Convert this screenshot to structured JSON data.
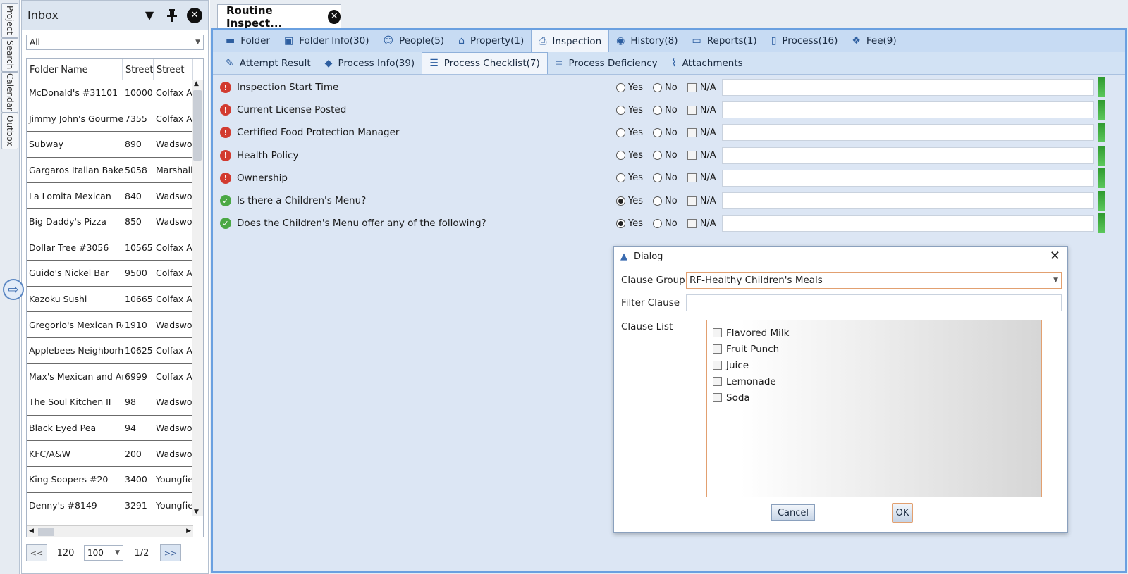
{
  "side_tabs": [
    "Project",
    "Search",
    "Calendar",
    "Outbox"
  ],
  "inbox": {
    "title": "Inbox",
    "filter": "All",
    "columns": [
      "Folder Name",
      "Street",
      "Street"
    ],
    "rows": [
      [
        "McDonald's #31101",
        "10000",
        "Colfax AV"
      ],
      [
        "Jimmy John's Gourmet S",
        "7355",
        "Colfax AV"
      ],
      [
        "Subway",
        "890",
        "Wadswor"
      ],
      [
        "Gargaros Italian Bakery",
        "5058",
        "Marshall"
      ],
      [
        "La Lomita Mexican",
        "840",
        "Wadswor"
      ],
      [
        "Big Daddy's Pizza",
        "850",
        "Wadswor"
      ],
      [
        "Dollar Tree #3056",
        "10565",
        "Colfax AV"
      ],
      [
        "Guido's Nickel Bar",
        "9500",
        "Colfax AV"
      ],
      [
        "Kazoku Sushi",
        "10665",
        "Colfax AV"
      ],
      [
        "Gregorio's Mexican Rest",
        "1910",
        "Wadswor"
      ],
      [
        "Applebees Neighborhoo",
        "10625",
        "Colfax AV"
      ],
      [
        "Max's Mexican and Ame",
        "6999",
        "Colfax AV"
      ],
      [
        "The Soul Kitchen II",
        "98",
        "Wadswor"
      ],
      [
        "Black Eyed Pea",
        "94",
        "Wadswor"
      ],
      [
        "KFC/A&W",
        "200",
        "Wadswor"
      ],
      [
        "King Soopers #20",
        "3400",
        "Youngfiel"
      ],
      [
        "Denny's #8149",
        "3291",
        "Youngfiel"
      ]
    ],
    "pager": {
      "prev": "<<",
      "total": "120",
      "page_size": "100",
      "page": "1/2",
      "next": ">>"
    }
  },
  "doc_tab": {
    "title": "Routine Inspect..."
  },
  "tabs_primary": [
    {
      "label": "Folder",
      "icon": "folder-icon"
    },
    {
      "label": "Folder Info(30)",
      "icon": "info-card-icon"
    },
    {
      "label": "People(5)",
      "icon": "people-icon"
    },
    {
      "label": "Property(1)",
      "icon": "house-icon"
    },
    {
      "label": "Inspection",
      "icon": "printer-icon"
    },
    {
      "label": "History(8)",
      "icon": "history-icon"
    },
    {
      "label": "Reports(1)",
      "icon": "monitor-icon"
    },
    {
      "label": "Process(16)",
      "icon": "document-icon"
    },
    {
      "label": "Fee(9)",
      "icon": "money-icon"
    }
  ],
  "tabs_secondary": [
    {
      "label": "Attempt Result",
      "icon": "edit-icon"
    },
    {
      "label": "Process Info(39)",
      "icon": "tag-icon"
    },
    {
      "label": "Process Checklist(7)",
      "icon": "checklist-icon"
    },
    {
      "label": "Process Deficiency",
      "icon": "list-icon"
    },
    {
      "label": "Attachments",
      "icon": "paperclip-icon"
    }
  ],
  "checklist": {
    "yes_label": "Yes",
    "no_label": "No",
    "na_label": "N/A",
    "items": [
      {
        "label": "Inspection Start Time",
        "status": "error",
        "answer": ""
      },
      {
        "label": "Current License Posted",
        "status": "error",
        "answer": ""
      },
      {
        "label": "Certified Food Protection Manager",
        "status": "error",
        "answer": ""
      },
      {
        "label": "Health Policy",
        "status": "error",
        "answer": ""
      },
      {
        "label": "Ownership",
        "status": "error",
        "answer": ""
      },
      {
        "label": "Is there a Children's Menu?",
        "status": "ok",
        "answer": "Yes"
      },
      {
        "label": "Does the Children's Menu offer any of the following?",
        "status": "ok",
        "answer": "Yes"
      }
    ]
  },
  "dialog": {
    "title": "Dialog",
    "clause_group_label": "Clause Group",
    "clause_group_value": "RF-Healthy Children's Meals",
    "filter_label": "Filter Clause",
    "filter_value": "",
    "list_label": "Clause List",
    "clauses": [
      "Flavored Milk",
      "Fruit Punch",
      "Juice",
      "Lemonade",
      "Soda"
    ],
    "cancel": "Cancel",
    "ok": "OK"
  },
  "colors": {
    "accent": "#6aa0e0",
    "error": "#d23b30",
    "ok": "#4aa845",
    "focus": "#e2a070"
  }
}
